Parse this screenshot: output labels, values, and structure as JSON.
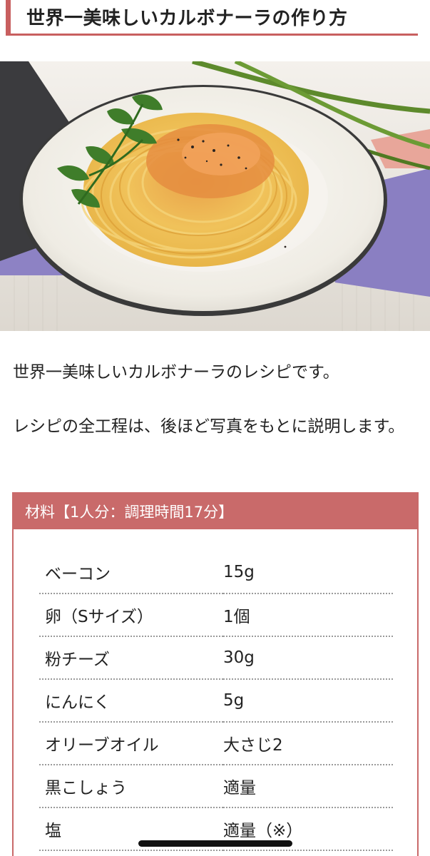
{
  "title": "世界一美味しいカルボナーラの作り方",
  "hero_image": {
    "description_icon": "carbonara-photo"
  },
  "intro": {
    "paragraph1": "世界一美味しいカルボナーラのレシピです。",
    "paragraph2": "レシピの全工程は、後ほど写真をもとに説明します。"
  },
  "ingredients": {
    "header": "材料【1人分：調理時間17分】",
    "rows": [
      {
        "name": "ベーコン",
        "amount": "15g"
      },
      {
        "name": "卵（Sサイズ）",
        "amount": "1個"
      },
      {
        "name": "粉チーズ",
        "amount": "30g"
      },
      {
        "name": "にんにく",
        "amount": "5g"
      },
      {
        "name": "オリーブオイル",
        "amount": "大さじ2"
      },
      {
        "name": "黒こしょう",
        "amount": "適量"
      },
      {
        "name": "塩",
        "amount": "適量（※）"
      }
    ]
  },
  "colors": {
    "accent": "#c85f5f",
    "header_bg": "#c96a6a"
  }
}
